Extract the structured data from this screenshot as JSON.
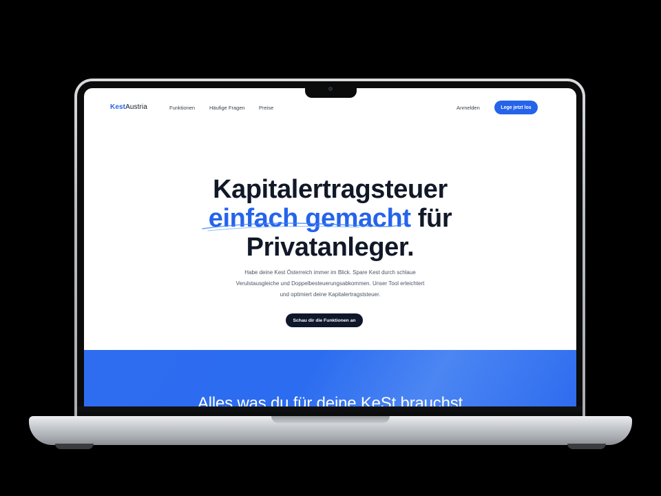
{
  "site": {
    "brand_prefix": "Kest",
    "brand_suffix": "Austria",
    "nav_links": [
      "Funktionen",
      "Häufige Fragen",
      "Preise"
    ],
    "signin_label": "Anmelden",
    "cta_label": "Lege jetzt los"
  },
  "hero": {
    "headline_line1": "Kapitalertragsteuer",
    "headline_accent": "einfach gemacht",
    "headline_rest": " für",
    "headline_line3": "Privatanleger.",
    "subtitle_lines": [
      "Habe deine Kest Österreich immer im Blick. Spare Kest durch schlaue",
      "Verulstausgleiche und Doppelbesteuerungsabkommen. Unser Tool erleichtert",
      "und optimiert deine Kapitalertragststeuer."
    ],
    "button_label": "Schau dir die Funktionen an"
  },
  "features": {
    "title": "Alles was du für deine KeSt brauchst"
  },
  "colors": {
    "accent": "#2563eb",
    "dark": "#0f172a",
    "section_blue": "#2f6df0"
  },
  "icons": {
    "camera": "camera-icon"
  }
}
